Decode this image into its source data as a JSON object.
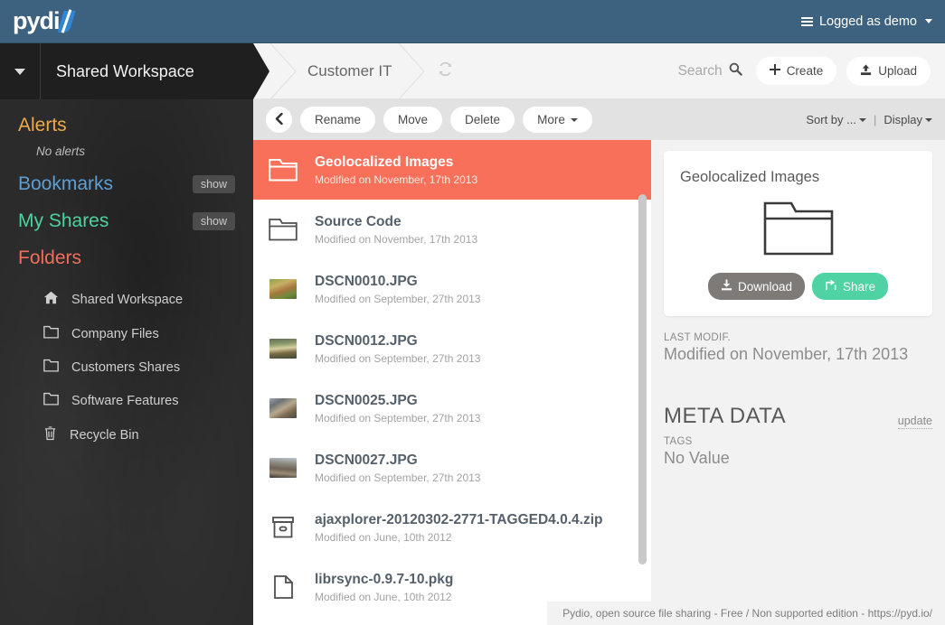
{
  "navbar": {
    "logo_text": "pydi",
    "logo_icon": "pydio-slash-logo",
    "user_menu_label": "Logged as demo",
    "menu_icon": "hamburger-icon",
    "caret_icon": "chevron-down-icon",
    "bg_color": "#3c6280"
  },
  "sidebar": {
    "workspace_title": "Shared Workspace",
    "workspace_caret_icon": "chevron-down-icon",
    "alerts": {
      "title": "Alerts",
      "empty_text": "No alerts",
      "color": "#efa84c"
    },
    "bookmarks": {
      "title": "Bookmarks",
      "action": "show",
      "color": "#5b9fd6"
    },
    "shares": {
      "title": "My Shares",
      "action": "show",
      "color": "#4fd39e"
    },
    "folders": {
      "title": "Folders",
      "color": "#ef6f5a",
      "items": [
        {
          "label": "Shared Workspace",
          "icon": "home-icon"
        },
        {
          "label": "Company Files",
          "icon": "folder-icon"
        },
        {
          "label": "Customers Shares",
          "icon": "folder-icon"
        },
        {
          "label": "Software Features",
          "icon": "folder-icon"
        },
        {
          "label": "Recycle Bin",
          "icon": "trash-icon"
        }
      ]
    }
  },
  "breadcrumb": {
    "current": "Customer IT",
    "refresh_icon": "refresh-icon",
    "search": {
      "label": "Search",
      "icon": "search-icon"
    },
    "create": {
      "label": "Create",
      "icon": "plus-icon"
    },
    "upload": {
      "label": "Upload",
      "icon": "upload-icon"
    }
  },
  "toolbar": {
    "back_icon": "chevron-left-icon",
    "rename": "Rename",
    "move": "Move",
    "delete": "Delete",
    "more": "More",
    "sort_by": "Sort by ...",
    "divider": "|",
    "display": "Display"
  },
  "filelist": {
    "selected_color": "#f87059",
    "items": [
      {
        "name": "Geolocalized Images",
        "date": "Modified on November, 17th 2013",
        "icon": "folder-icon",
        "selected": true
      },
      {
        "name": "Source Code",
        "date": "Modified on November, 17th 2013",
        "icon": "folder-icon",
        "selected": false
      },
      {
        "name": "DSCN0010.JPG",
        "date": "Modified on September, 27th 2013",
        "icon": "image-thumbnail",
        "selected": false
      },
      {
        "name": "DSCN0012.JPG",
        "date": "Modified on September, 27th 2013",
        "icon": "image-thumbnail",
        "selected": false
      },
      {
        "name": "DSCN0025.JPG",
        "date": "Modified on September, 27th 2013",
        "icon": "image-thumbnail",
        "selected": false
      },
      {
        "name": "DSCN0027.JPG",
        "date": "Modified on September, 27th 2013",
        "icon": "image-thumbnail",
        "selected": false
      },
      {
        "name": "ajaxplorer-20120302-2771-TAGGED4.0.4.zip",
        "date": "Modified on June, 10th 2012",
        "icon": "archive-icon",
        "selected": false
      },
      {
        "name": "librsync-0.9.7-10.pkg",
        "date": "Modified on June, 10th 2012",
        "icon": "document-icon",
        "selected": false
      }
    ]
  },
  "detail": {
    "title": "Geolocalized Images",
    "preview_icon": "folder-icon",
    "download": {
      "label": "Download",
      "icon": "download-icon",
      "color": "#7d7a78"
    },
    "share": {
      "label": "Share",
      "icon": "share-icon",
      "color": "#4fd3a4"
    },
    "last_modif_label": "LAST MODIF.",
    "last_modif_value": "Modified on November, 17th 2013",
    "meta_data_heading": "META DATA",
    "meta_update_link": "update",
    "tags_label": "TAGS",
    "tags_value": "No Value"
  },
  "footer": {
    "text": "Pydio, open source file sharing - Free / Non supported edition - https://pyd.io/"
  }
}
